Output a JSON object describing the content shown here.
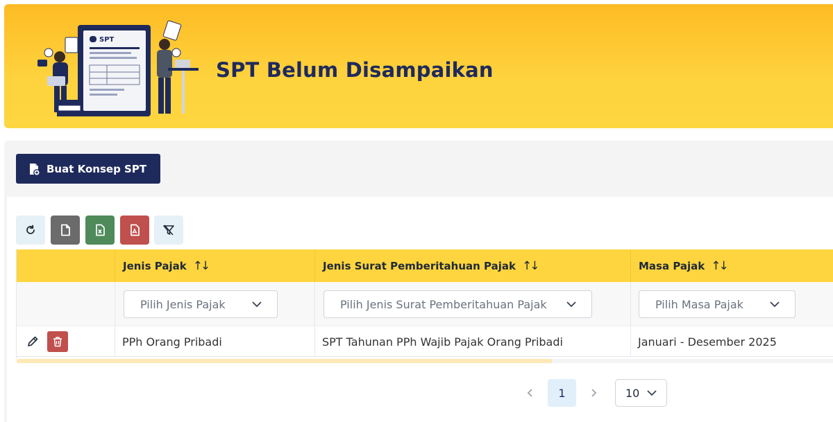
{
  "banner": {
    "title": "SPT Belum Disampaikan",
    "illustration_label": "SPT"
  },
  "actions": {
    "create_label": "Buat Konsep SPT"
  },
  "toolbar": {
    "buttons": [
      {
        "name": "refresh",
        "icon": "refresh-icon",
        "color": "#e6f0f7"
      },
      {
        "name": "export-file",
        "icon": "file-icon",
        "color": "#6b6b6b"
      },
      {
        "name": "export-excel",
        "icon": "excel-icon",
        "color": "#4e8a5a"
      },
      {
        "name": "export-pdf",
        "icon": "pdf-icon",
        "color": "#c0504d"
      },
      {
        "name": "clear-filter",
        "icon": "filter-clear-icon",
        "color": "#e6f0f7"
      }
    ]
  },
  "table": {
    "columns": [
      {
        "label": "Jenis Pajak",
        "filter_placeholder": "Pilih Jenis Pajak"
      },
      {
        "label": "Jenis Surat Pemberitahuan Pajak",
        "filter_placeholder": "Pilih Jenis Surat Pemberitahuan Pajak"
      },
      {
        "label": "Masa Pajak",
        "filter_placeholder": "Pilih Masa Pajak"
      }
    ],
    "rows": [
      [
        "PPh Orang Pribadi",
        "SPT Tahunan PPh Wajib Pajak Orang Pribadi",
        "Januari - Desember 2025"
      ]
    ]
  },
  "pagination": {
    "current_page": "1",
    "page_size": "10"
  },
  "colors": {
    "brand_navy": "#1f2a5c",
    "header_yellow": "#fed53e",
    "delete_red": "#c0504d"
  }
}
